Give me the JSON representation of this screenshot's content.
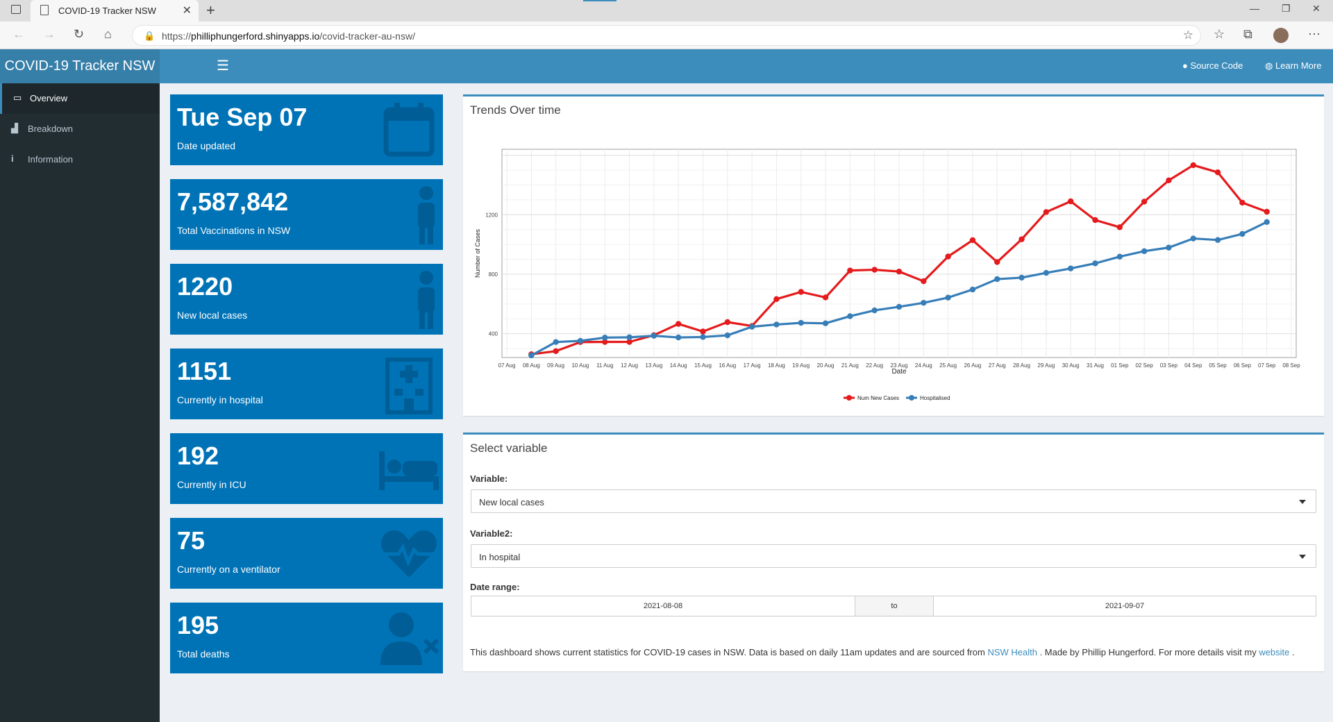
{
  "browser": {
    "tab_title": "COVID-19 Tracker NSW",
    "url_prefix": "https://",
    "url_host": "philliphungerford.shinyapps.io",
    "url_path": "/covid-tracker-au-nsw/"
  },
  "header": {
    "title": "COVID-19 Tracker NSW",
    "source_code": "Source Code",
    "learn_more": "Learn More"
  },
  "sidebar": {
    "items": [
      {
        "label": "Overview",
        "icon": "desktop-icon"
      },
      {
        "label": "Breakdown",
        "icon": "bar-chart-icon"
      },
      {
        "label": "Information",
        "icon": "info-icon"
      }
    ]
  },
  "value_boxes": [
    {
      "value": "Tue Sep 07",
      "label": "Date updated",
      "icon": "calendar-icon"
    },
    {
      "value": "7,587,842",
      "label": "Total Vaccinations in NSW",
      "icon": "person-icon"
    },
    {
      "value": "1220",
      "label": "New local cases",
      "icon": "person-icon"
    },
    {
      "value": "1151",
      "label": "Currently in hospital",
      "icon": "hospital-icon"
    },
    {
      "value": "192",
      "label": "Currently in ICU",
      "icon": "bed-icon"
    },
    {
      "value": "75",
      "label": "Currently on a ventilator",
      "icon": "heartbeat-icon"
    },
    {
      "value": "195",
      "label": "Total deaths",
      "icon": "user-times-icon"
    }
  ],
  "trends_panel": {
    "title": "Trends Over time"
  },
  "select_panel": {
    "title": "Select variable",
    "variable_label": "Variable:",
    "variable_value": "New local cases",
    "variable2_label": "Variable2:",
    "variable2_value": "In hospital",
    "date_range_label": "Date range:",
    "date_from": "2021-08-08",
    "date_to_word": "to",
    "date_to": "2021-09-07",
    "footnote_pre": "This dashboard shows current statistics for COVID-19 cases in NSW. Data is based on daily 11am updates and are sourced from ",
    "footnote_link1": "NSW Health",
    "footnote_mid": " . Made by Phillip Hungerford. For more details visit my ",
    "footnote_link2": "website",
    "footnote_end": " ."
  },
  "chart_data": {
    "type": "line",
    "xlabel": "Date",
    "ylabel": "Number of Cases",
    "x_ticks": [
      "07 Aug",
      "08 Aug",
      "09 Aug",
      "10 Aug",
      "11 Aug",
      "12 Aug",
      "13 Aug",
      "14 Aug",
      "15 Aug",
      "16 Aug",
      "17 Aug",
      "18 Aug",
      "19 Aug",
      "20 Aug",
      "21 Aug",
      "22 Aug",
      "23 Aug",
      "24 Aug",
      "25 Aug",
      "26 Aug",
      "27 Aug",
      "28 Aug",
      "29 Aug",
      "30 Aug",
      "31 Aug",
      "01 Sep",
      "02 Sep",
      "03 Sep",
      "04 Sep",
      "05 Sep",
      "06 Sep",
      "07 Sep",
      "08 Sep"
    ],
    "y_ticks": [
      400,
      800,
      1200
    ],
    "ylim": [
      240,
      1640
    ],
    "grid": true,
    "legend": "bottom",
    "categories": [
      "08 Aug",
      "09 Aug",
      "10 Aug",
      "11 Aug",
      "12 Aug",
      "13 Aug",
      "14 Aug",
      "15 Aug",
      "16 Aug",
      "17 Aug",
      "18 Aug",
      "19 Aug",
      "20 Aug",
      "21 Aug",
      "22 Aug",
      "23 Aug",
      "24 Aug",
      "25 Aug",
      "26 Aug",
      "27 Aug",
      "28 Aug",
      "29 Aug",
      "30 Aug",
      "31 Aug",
      "01 Sep",
      "02 Sep",
      "03 Sep",
      "04 Sep",
      "05 Sep",
      "06 Sep",
      "07 Sep"
    ],
    "series": [
      {
        "name": "Num New Cases",
        "color": "#e41a1c",
        "values": [
          262,
          283,
          344,
          345,
          345,
          390,
          466,
          415,
          478,
          452,
          633,
          681,
          644,
          825,
          830,
          818,
          753,
          919,
          1029,
          882,
          1035,
          1218,
          1290,
          1164,
          1116,
          1288,
          1431,
          1533,
          1485,
          1281,
          1220
        ]
      },
      {
        "name": "Hospitalised",
        "color": "#377eb8",
        "values": [
          254,
          344,
          352,
          374,
          376,
          386,
          375,
          378,
          389,
          447,
          462,
          473,
          470,
          518,
          557,
          581,
          608,
          643,
          697,
          767,
          777,
          809,
          839,
          873,
          918,
          955,
          979,
          1040,
          1030,
          1071,
          1151
        ]
      }
    ]
  }
}
